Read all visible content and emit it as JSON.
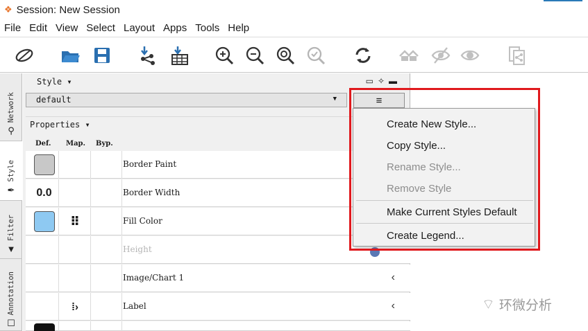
{
  "window": {
    "title": "Session: New Session",
    "accent": "#2a7ab8"
  },
  "menubar": {
    "items": [
      "File",
      "Edit",
      "View",
      "Select",
      "Layout",
      "Apps",
      "Tools",
      "Help"
    ]
  },
  "toolbar": {
    "icons": [
      "network-logo-icon",
      "open-folder-icon",
      "save-icon",
      "import-network-icon",
      "import-table-icon",
      "zoom-in-icon",
      "zoom-out-icon",
      "zoom-fit-icon",
      "zoom-selected-icon",
      "refresh-layout-icon",
      "home-icon",
      "hide-icon",
      "show-icon",
      "export-icon"
    ]
  },
  "sidebar": {
    "tabs": [
      {
        "label": "Network",
        "icon": "network-icon"
      },
      {
        "label": "Style",
        "icon": "brush-icon",
        "active": true
      },
      {
        "label": "Filter",
        "icon": "filter-icon"
      },
      {
        "label": "Annotation",
        "icon": "annotation-icon"
      }
    ]
  },
  "style_panel": {
    "header": "Style ▾",
    "selected_style": "default",
    "menu_button": "≡",
    "properties_label": "Properties ▾",
    "columns": {
      "def": "Def.",
      "map": "Map.",
      "byp": "Byp."
    },
    "rows": [
      {
        "label": "Border Paint",
        "def": "",
        "def_color": "#c8c8c8",
        "map": "",
        "disabled": false,
        "arrow": ""
      },
      {
        "label": "Border Width",
        "def": "0.0",
        "map": "",
        "disabled": false,
        "arrow": ""
      },
      {
        "label": "Fill Color",
        "def": "",
        "def_color": "#8ec9f2",
        "map": "⠿",
        "disabled": false,
        "arrow": ""
      },
      {
        "label": "Height",
        "def": "",
        "map": "",
        "disabled": true,
        "arrow": ""
      },
      {
        "label": "Image/Chart 1",
        "def": "",
        "map": "",
        "disabled": false,
        "arrow": "‹"
      },
      {
        "label": "Label",
        "def": "",
        "map": "⁞›",
        "disabled": false,
        "arrow": "‹"
      }
    ]
  },
  "dropdown": {
    "items": [
      {
        "label": "Create New Style...",
        "enabled": true
      },
      {
        "label": "Copy Style...",
        "enabled": true
      },
      {
        "label": "Rename Style...",
        "enabled": false
      },
      {
        "label": "Remove Style",
        "enabled": false
      },
      {
        "label": "Make Current Styles Default",
        "enabled": true
      },
      {
        "label": "Create Legend...",
        "enabled": true
      }
    ],
    "highlight_color": "#e0191d"
  },
  "watermark": {
    "text": "环微分析"
  }
}
